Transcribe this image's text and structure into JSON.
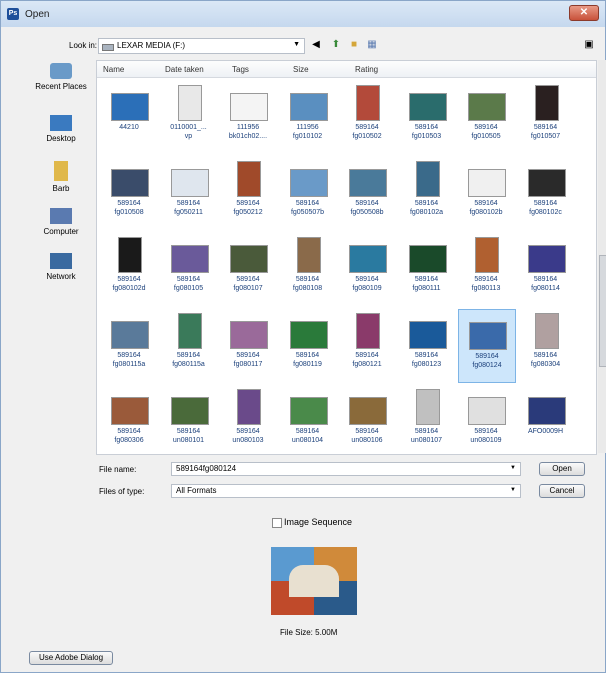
{
  "window": {
    "title": "Open",
    "app_icon_text": "Ps",
    "close_symbol": "✕"
  },
  "toolbar": {
    "lookin_label": "Look in:",
    "lookin_value": "LEXAR MEDIA (F:)",
    "back_icon": "back-icon",
    "up_icon": "up-folder-icon",
    "newfolder_icon": "new-folder-icon",
    "views_icon": "views-icon"
  },
  "places": [
    {
      "label": "Recent Places",
      "icon": "recent-places-icon"
    },
    {
      "label": "Desktop",
      "icon": "desktop-icon"
    },
    {
      "label": "Barb",
      "icon": "user-folder-icon"
    },
    {
      "label": "Computer",
      "icon": "computer-icon"
    },
    {
      "label": "Network",
      "icon": "network-icon"
    }
  ],
  "columns": [
    "Name",
    "Date taken",
    "Tags",
    "Size",
    "Rating"
  ],
  "files": [
    {
      "name": "44210",
      "line2": ""
    },
    {
      "name": "0110001_...",
      "line2": "vp"
    },
    {
      "name": "111956",
      "line2": "bk01ch02...."
    },
    {
      "name": "111956",
      "line2": "fg010102"
    },
    {
      "name": "589164",
      "line2": "fg010502"
    },
    {
      "name": "589164",
      "line2": "fg010503"
    },
    {
      "name": "589164",
      "line2": "fg010505"
    },
    {
      "name": "589164",
      "line2": "fg010507"
    },
    {
      "name": "589164",
      "line2": "fg010508"
    },
    {
      "name": "589164",
      "line2": "fg050211"
    },
    {
      "name": "589164",
      "line2": "fg050212"
    },
    {
      "name": "589164",
      "line2": "fg050507b"
    },
    {
      "name": "589164",
      "line2": "fg050508b"
    },
    {
      "name": "589164",
      "line2": "fg080102a"
    },
    {
      "name": "589164",
      "line2": "fg080102b"
    },
    {
      "name": "589164",
      "line2": "fg080102c"
    },
    {
      "name": "589164",
      "line2": "fg080102d"
    },
    {
      "name": "589164",
      "line2": "fg080105"
    },
    {
      "name": "589164",
      "line2": "fg080107"
    },
    {
      "name": "589164",
      "line2": "fg080108"
    },
    {
      "name": "589164",
      "line2": "fg080109"
    },
    {
      "name": "589164",
      "line2": "fg080111"
    },
    {
      "name": "589164",
      "line2": "fg080113"
    },
    {
      "name": "589164",
      "line2": "fg080114"
    },
    {
      "name": "589164",
      "line2": "fg080115a"
    },
    {
      "name": "589164",
      "line2": "fg080115a"
    },
    {
      "name": "589164",
      "line2": "fg080117"
    },
    {
      "name": "589164",
      "line2": "fg080119"
    },
    {
      "name": "589164",
      "line2": "fg080121"
    },
    {
      "name": "589164",
      "line2": "fg080123"
    },
    {
      "name": "589164",
      "line2": "fg080124"
    },
    {
      "name": "589164",
      "line2": "fg080304"
    },
    {
      "name": "589164",
      "line2": "fg080306"
    },
    {
      "name": "589164",
      "line2": "un080101"
    },
    {
      "name": "589164",
      "line2": "un080103"
    },
    {
      "name": "589164",
      "line2": "un080104"
    },
    {
      "name": "589164",
      "line2": "un080106"
    },
    {
      "name": "589164",
      "line2": "un080107"
    },
    {
      "name": "589164",
      "line2": "un080109"
    },
    {
      "name": "AFO0009H",
      "line2": ""
    }
  ],
  "selected_index": 30,
  "thumb_colors": [
    "#2b6fb8",
    "#e8e8e8",
    "#f4f4f4",
    "#5a8fc0",
    "#b34a3a",
    "#2a6c6c",
    "#5b7a4a",
    "#2a2020",
    "#3a4c6a",
    "#dfe6ee",
    "#a04a2a",
    "#6a9ac8",
    "#4a7a9a",
    "#3a6a8a",
    "#f0f0f0",
    "#2a2a2a",
    "#1a1a1a",
    "#6a5a9a",
    "#4a5a3a",
    "#8a6a4a",
    "#2a7aa0",
    "#1a4a2a",
    "#b06030",
    "#3a3a8a",
    "#5a7a9a",
    "#3a7a5a",
    "#9a6a9a",
    "#2a7a3a",
    "#8a3a6a",
    "#1a5a9a",
    "#3a6aaa",
    "#b0a0a0",
    "#9a5a3a",
    "#4a6a3a",
    "#6a4a8a",
    "#4a8a4a",
    "#8a6a3a",
    "#c0c0c0",
    "#e0e0e0",
    "#2a3a7a"
  ],
  "filename": {
    "label": "File name:",
    "value": "589164fg080124"
  },
  "filetype": {
    "label": "Files of type:",
    "value": "All Formats"
  },
  "buttons": {
    "open": "Open",
    "cancel": "Cancel",
    "adobe": "Use Adobe Dialog"
  },
  "image_sequence_label": "Image Sequence",
  "file_size": "File Size: 5.00M"
}
